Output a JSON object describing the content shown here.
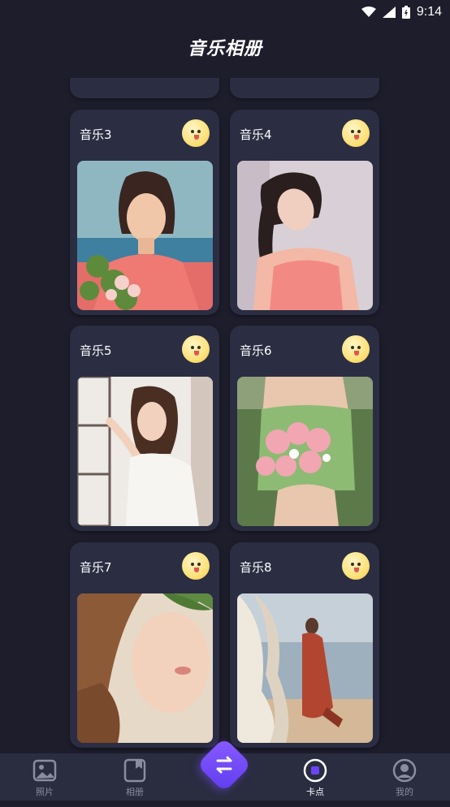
{
  "status_bar": {
    "time": "9:14"
  },
  "header": {
    "title": "音乐相册"
  },
  "cards": [
    {
      "label": "音乐3"
    },
    {
      "label": "音乐4"
    },
    {
      "label": "音乐5"
    },
    {
      "label": "音乐6"
    },
    {
      "label": "音乐7"
    },
    {
      "label": "音乐8"
    }
  ],
  "bottom_nav": {
    "items": [
      {
        "label": "照片",
        "icon": "photo-icon"
      },
      {
        "label": "相册",
        "icon": "album-icon"
      },
      {
        "label": "",
        "icon": "swap-arrows-icon"
      },
      {
        "label": "卡点",
        "icon": "beat-icon"
      },
      {
        "label": "我的",
        "icon": "profile-icon"
      }
    ]
  },
  "colors": {
    "background": "#1d1d2c",
    "card": "#2b2d42",
    "accent": "#6a45f5",
    "nav": "#2a2c40"
  }
}
